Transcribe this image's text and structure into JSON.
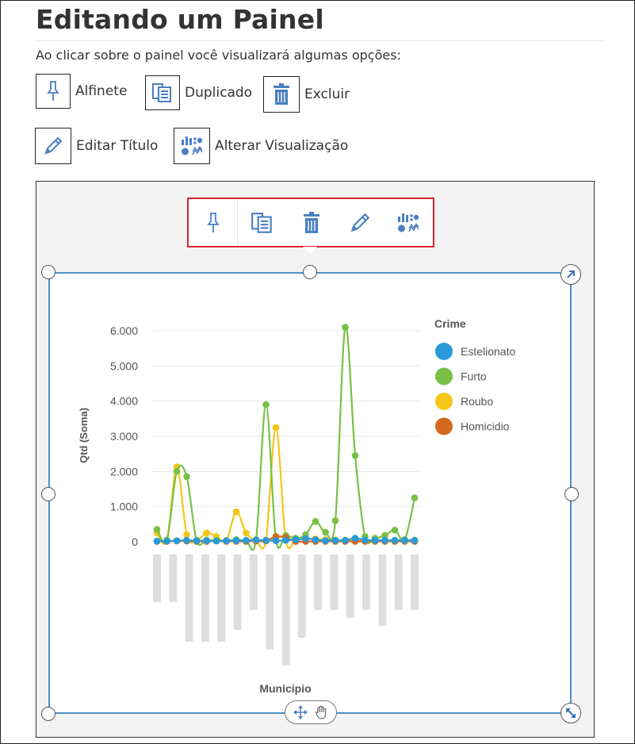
{
  "page": {
    "title": "Editando um Painel",
    "intro": "Ao clicar sobre o painel você visualizará algumas opções:"
  },
  "options": [
    {
      "label": "Alfinete",
      "icon": "pin-icon"
    },
    {
      "label": "Duplicado",
      "icon": "duplicate-icon"
    },
    {
      "label": "Excluir",
      "icon": "trash-icon"
    },
    {
      "label": "Editar Título",
      "icon": "pencil-icon"
    },
    {
      "label": "Alterar Visualização",
      "icon": "change-visualization-icon"
    }
  ],
  "colors": {
    "accent": "#4a7fc1",
    "highlight_border": "#d9262c",
    "panel_border": "#4a90c8"
  },
  "chart_data": {
    "type": "line",
    "xlabel": "Municipio",
    "ylabel": "Qtd (Soma)",
    "ylim": [
      0,
      6000
    ],
    "yticks": [
      0,
      1000,
      2000,
      3000,
      4000,
      5000,
      6000
    ],
    "ytick_labels": [
      "0",
      "1.000",
      "2.000",
      "3.000",
      "4.000",
      "5.000",
      "6.000"
    ],
    "grid": true,
    "legend_title": "Crime",
    "legend_position": "right",
    "x_count": 27,
    "series": [
      {
        "name": "Estelionato",
        "color": "#2b9ad8",
        "values": [
          20,
          20,
          30,
          40,
          30,
          30,
          20,
          30,
          30,
          40,
          50,
          40,
          30,
          40,
          60,
          90,
          60,
          30,
          40,
          40,
          100,
          50,
          40,
          40,
          40,
          40,
          40
        ]
      },
      {
        "name": "Furto",
        "color": "#78c046",
        "values": [
          350,
          50,
          2000,
          1850,
          40,
          50,
          40,
          30,
          60,
          30,
          60,
          3900,
          80,
          180,
          100,
          200,
          580,
          270,
          600,
          6100,
          2450,
          150,
          100,
          180,
          330,
          60,
          1250
        ]
      },
      {
        "name": "Roubo",
        "color": "#f5c518",
        "values": [
          250,
          40,
          2130,
          200,
          30,
          250,
          150,
          40,
          850,
          250,
          40,
          50,
          3250,
          50,
          60,
          100,
          80,
          60,
          50,
          50,
          50,
          50,
          40,
          50,
          40,
          50,
          50
        ]
      },
      {
        "name": "Homicidio",
        "color": "#d2691e",
        "values": [
          10,
          10,
          20,
          20,
          10,
          10,
          20,
          10,
          10,
          10,
          20,
          20,
          150,
          120,
          10,
          10,
          10,
          10,
          10,
          10,
          10,
          10,
          10,
          10,
          10,
          10,
          10
        ]
      }
    ]
  }
}
